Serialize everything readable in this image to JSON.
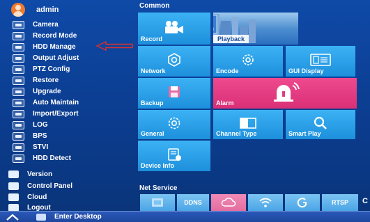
{
  "user": {
    "name": "admin"
  },
  "menu": {
    "items": [
      {
        "label": "Camera",
        "icon": "camera-icon"
      },
      {
        "label": "Record Mode",
        "icon": "record-mode-icon"
      },
      {
        "label": "HDD Manage",
        "icon": "hdd-icon"
      },
      {
        "label": "Output Adjust",
        "icon": "output-adjust-icon"
      },
      {
        "label": "PTZ Config",
        "icon": "ptz-icon"
      },
      {
        "label": "Restore",
        "icon": "restore-icon"
      },
      {
        "label": "Upgrade",
        "icon": "upgrade-icon"
      },
      {
        "label": "Auto Maintain",
        "icon": "auto-maintain-icon"
      },
      {
        "label": "Import/Export",
        "icon": "import-export-icon"
      },
      {
        "label": "LOG",
        "icon": "log-icon"
      },
      {
        "label": "BPS",
        "icon": "bps-icon"
      },
      {
        "label": "STVI",
        "icon": "stvi-icon"
      },
      {
        "label": "HDD Detect",
        "icon": "hdd-detect-icon"
      }
    ],
    "outer": [
      {
        "label": "Version",
        "icon": "version-icon"
      },
      {
        "label": "Control Panel",
        "icon": "control-panel-icon"
      },
      {
        "label": "Cloud",
        "icon": "cloud-icon"
      },
      {
        "label": "Logout",
        "icon": "logout-icon"
      }
    ]
  },
  "common": {
    "title": "Common",
    "tiles": {
      "record": "Record",
      "playback": "Playback",
      "network": "Network",
      "encode": "Encode",
      "gui_display": "GUI Display",
      "backup": "Backup",
      "alarm": "Alarm",
      "general": "General",
      "channel_type": "Channel Type",
      "smart_play": "Smart Play",
      "device_info": "Device Info"
    }
  },
  "net_service": {
    "title": "Net Service",
    "tiles": [
      "",
      "DDNS",
      "",
      "",
      "",
      "RTSP"
    ],
    "overflow": "C"
  },
  "taskbar": {
    "label": "Enter Desktop"
  },
  "colors": {
    "background": "#0d3f96",
    "tile_blue": "#2aa0e8",
    "tile_pink": "#e43a82",
    "arrow_red": "#e0302a"
  }
}
